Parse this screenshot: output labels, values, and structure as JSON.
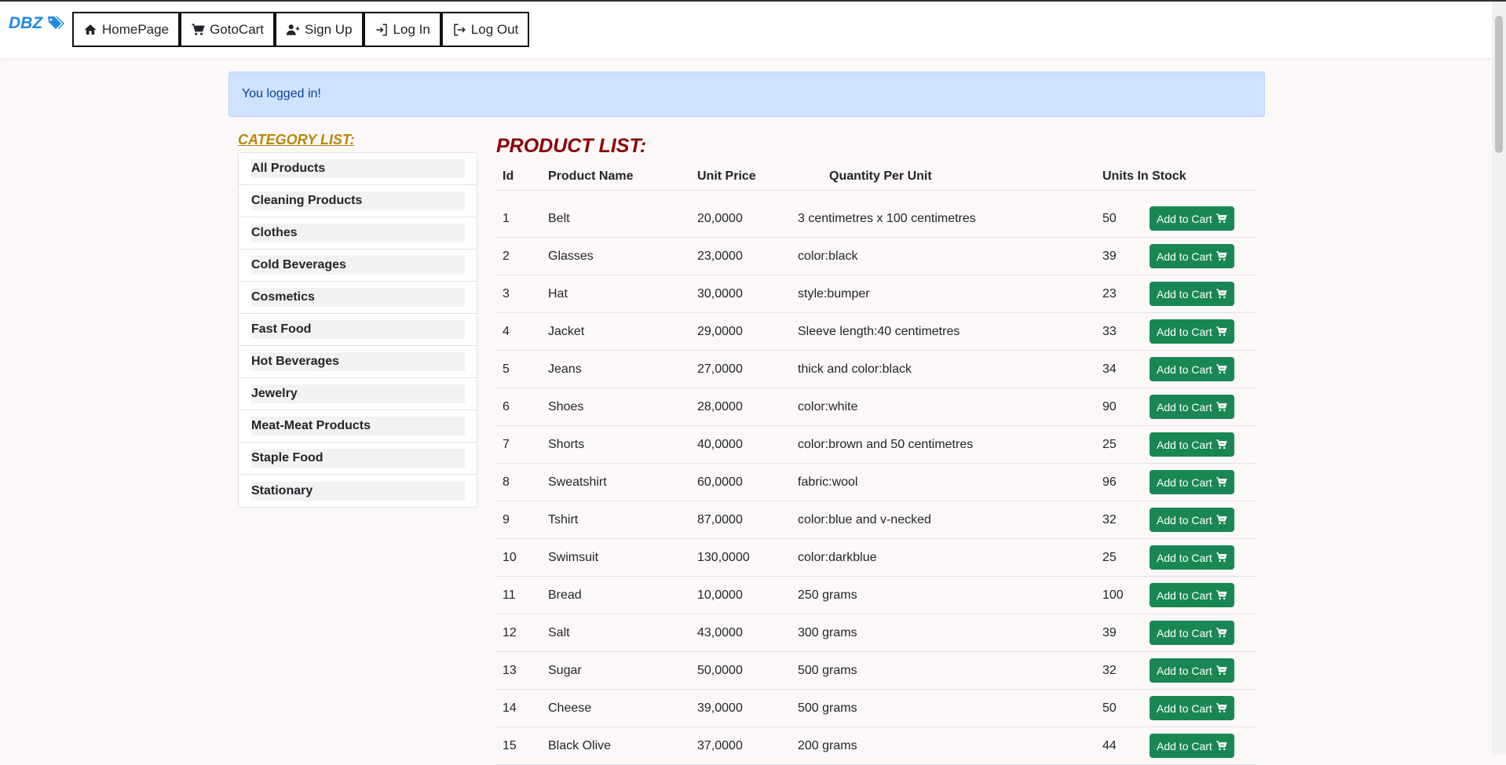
{
  "brand": {
    "label": "DBZ",
    "icon": "tags-icon",
    "color": "#1e88e5"
  },
  "nav": {
    "items": [
      {
        "label": "HomePage",
        "icon": "home-icon"
      },
      {
        "label": "GotoCart",
        "icon": "cart-icon"
      },
      {
        "label": "Sign Up",
        "icon": "user-plus-icon"
      },
      {
        "label": "Log In",
        "icon": "login-icon"
      },
      {
        "label": "Log Out",
        "icon": "logout-icon"
      }
    ]
  },
  "alert": {
    "message": "You logged in!"
  },
  "categories": {
    "title": "CATEGORY LIST:",
    "items": [
      "All Products",
      "Cleaning Products",
      "Clothes",
      "Cold Beverages",
      "Cosmetics",
      "Fast Food",
      "Hot Beverages",
      "Jewelry",
      "Meat-Meat Products",
      "Staple Food",
      "Stationary"
    ]
  },
  "products": {
    "title": "PRODUCT LIST:",
    "columns": [
      "Id",
      "Product Name",
      "Unit Price",
      "Quantity Per Unit",
      "Units In Stock"
    ],
    "add_label": "Add to Cart",
    "rows": [
      {
        "id": "1",
        "name": "Belt",
        "price": "20,0000",
        "qty": "3 centimetres x 100 centimetres",
        "stock": "50"
      },
      {
        "id": "2",
        "name": "Glasses",
        "price": "23,0000",
        "qty": "color:black",
        "stock": "39"
      },
      {
        "id": "3",
        "name": "Hat",
        "price": "30,0000",
        "qty": "style:bumper",
        "stock": "23"
      },
      {
        "id": "4",
        "name": "Jacket",
        "price": "29,0000",
        "qty": "Sleeve length:40 centimetres",
        "stock": "33"
      },
      {
        "id": "5",
        "name": "Jeans",
        "price": "27,0000",
        "qty": "thick and color:black",
        "stock": "34"
      },
      {
        "id": "6",
        "name": "Shoes",
        "price": "28,0000",
        "qty": "color:white",
        "stock": "90"
      },
      {
        "id": "7",
        "name": "Shorts",
        "price": "40,0000",
        "qty": "color:brown and 50 centimetres",
        "stock": "25"
      },
      {
        "id": "8",
        "name": "Sweatshirt",
        "price": "60,0000",
        "qty": "fabric:wool",
        "stock": "96"
      },
      {
        "id": "9",
        "name": "Tshirt",
        "price": "87,0000",
        "qty": "color:blue and v-necked",
        "stock": "32"
      },
      {
        "id": "10",
        "name": "Swimsuit",
        "price": "130,0000",
        "qty": "color:darkblue",
        "stock": "25"
      },
      {
        "id": "11",
        "name": "Bread",
        "price": "10,0000",
        "qty": "250 grams",
        "stock": "100"
      },
      {
        "id": "12",
        "name": "Salt",
        "price": "43,0000",
        "qty": "300 grams",
        "stock": "39"
      },
      {
        "id": "13",
        "name": "Sugar",
        "price": "50,0000",
        "qty": "500 grams",
        "stock": "32"
      },
      {
        "id": "14",
        "name": "Cheese",
        "price": "39,0000",
        "qty": "500 grams",
        "stock": "50"
      },
      {
        "id": "15",
        "name": "Black Olive",
        "price": "37,0000",
        "qty": "200 grams",
        "stock": "44"
      }
    ]
  },
  "colors": {
    "accent_green": "#198754",
    "category_title": "#b8860b",
    "product_title": "#8b0000",
    "alert_bg": "#cfe2ff"
  }
}
